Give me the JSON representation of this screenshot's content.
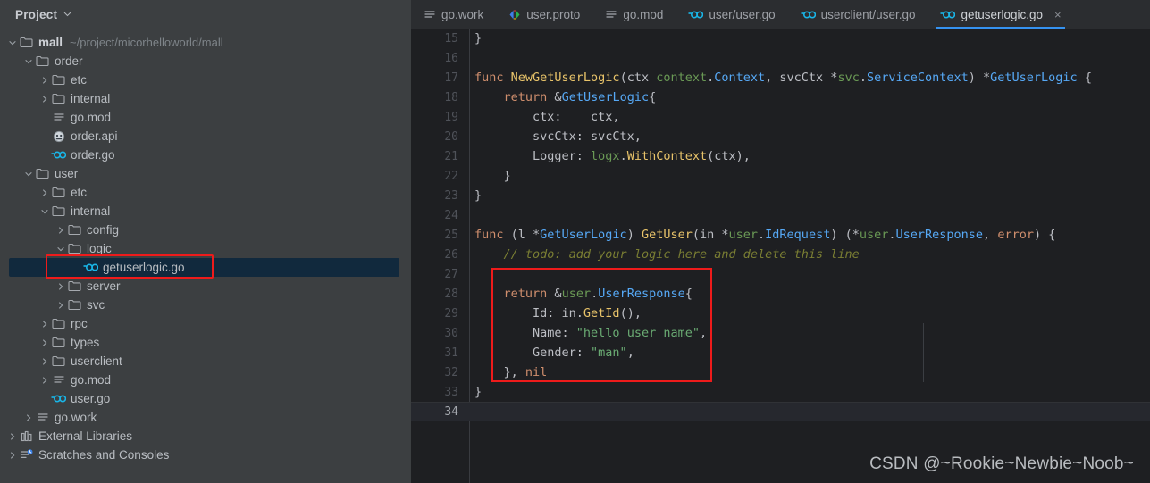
{
  "sidebar": {
    "header": {
      "title": "Project",
      "chevron_icon": "chevron-down-icon"
    },
    "tree": [
      {
        "indent": 0,
        "twisty": "down",
        "icon": "folder-icon",
        "label": "mall",
        "bold": true,
        "sub": "~/project/micorhelloworld/mall"
      },
      {
        "indent": 1,
        "twisty": "down",
        "icon": "folder-icon",
        "label": "order",
        "bold": false,
        "sub": ""
      },
      {
        "indent": 2,
        "twisty": "right",
        "icon": "folder-icon",
        "label": "etc",
        "bold": false,
        "sub": ""
      },
      {
        "indent": 2,
        "twisty": "right",
        "icon": "folder-icon",
        "label": "internal",
        "bold": false,
        "sub": ""
      },
      {
        "indent": 2,
        "twisty": "none",
        "icon": "text-file-icon",
        "label": "go.mod",
        "bold": false,
        "sub": ""
      },
      {
        "indent": 2,
        "twisty": "none",
        "icon": "api-file-icon",
        "label": "order.api",
        "bold": false,
        "sub": ""
      },
      {
        "indent": 2,
        "twisty": "none",
        "icon": "go-file-icon",
        "label": "order.go",
        "bold": false,
        "sub": ""
      },
      {
        "indent": 1,
        "twisty": "down",
        "icon": "folder-icon",
        "label": "user",
        "bold": false,
        "sub": ""
      },
      {
        "indent": 2,
        "twisty": "right",
        "icon": "folder-icon",
        "label": "etc",
        "bold": false,
        "sub": ""
      },
      {
        "indent": 2,
        "twisty": "down",
        "icon": "folder-icon",
        "label": "internal",
        "bold": false,
        "sub": ""
      },
      {
        "indent": 3,
        "twisty": "right",
        "icon": "folder-icon",
        "label": "config",
        "bold": false,
        "sub": ""
      },
      {
        "indent": 3,
        "twisty": "down",
        "icon": "folder-icon",
        "label": "logic",
        "bold": false,
        "sub": ""
      },
      {
        "indent": 4,
        "twisty": "none",
        "icon": "go-file-icon",
        "label": "getuserlogic.go",
        "bold": false,
        "sub": "",
        "selected": true
      },
      {
        "indent": 3,
        "twisty": "right",
        "icon": "folder-icon",
        "label": "server",
        "bold": false,
        "sub": ""
      },
      {
        "indent": 3,
        "twisty": "right",
        "icon": "folder-icon",
        "label": "svc",
        "bold": false,
        "sub": ""
      },
      {
        "indent": 2,
        "twisty": "right",
        "icon": "folder-icon",
        "label": "rpc",
        "bold": false,
        "sub": ""
      },
      {
        "indent": 2,
        "twisty": "right",
        "icon": "folder-icon",
        "label": "types",
        "bold": false,
        "sub": ""
      },
      {
        "indent": 2,
        "twisty": "right",
        "icon": "folder-icon",
        "label": "userclient",
        "bold": false,
        "sub": ""
      },
      {
        "indent": 2,
        "twisty": "right",
        "icon": "text-file-icon",
        "label": "go.mod",
        "bold": false,
        "sub": ""
      },
      {
        "indent": 2,
        "twisty": "none",
        "icon": "go-file-icon",
        "label": "user.go",
        "bold": false,
        "sub": ""
      },
      {
        "indent": 1,
        "twisty": "right",
        "icon": "text-file-icon",
        "label": "go.work",
        "bold": false,
        "sub": ""
      },
      {
        "indent": 0,
        "twisty": "right",
        "icon": "library-icon",
        "label": "External Libraries",
        "bold": false,
        "sub": ""
      },
      {
        "indent": 0,
        "twisty": "right",
        "icon": "scratches-icon",
        "label": "Scratches and Consoles",
        "bold": false,
        "sub": ""
      }
    ]
  },
  "tabs": [
    {
      "label": "go.work",
      "icon": "text-file-icon",
      "active": false,
      "closable": false
    },
    {
      "label": "user.proto",
      "icon": "proto-file-icon",
      "active": false,
      "closable": false
    },
    {
      "label": "go.mod",
      "icon": "text-file-icon",
      "active": false,
      "closable": false
    },
    {
      "label": "user/user.go",
      "icon": "go-file-icon",
      "active": false,
      "closable": false
    },
    {
      "label": "userclient/user.go",
      "icon": "go-file-icon",
      "active": false,
      "closable": false
    },
    {
      "label": "getuserlogic.go",
      "icon": "go-file-icon",
      "active": true,
      "closable": true,
      "close_label": "×"
    }
  ],
  "editor": {
    "lines": [
      {
        "num": "15",
        "tokens": [
          {
            "t": "}",
            "c": "plain"
          }
        ],
        "current": false
      },
      {
        "num": "16",
        "tokens": [],
        "current": false
      },
      {
        "num": "17",
        "tokens": [
          {
            "t": "func ",
            "c": "kw"
          },
          {
            "t": "NewGetUserLogic",
            "c": "fn"
          },
          {
            "t": "(ctx ",
            "c": "plain"
          },
          {
            "t": "context",
            "c": "pkg"
          },
          {
            "t": ".",
            "c": "plain"
          },
          {
            "t": "Context",
            "c": "typ"
          },
          {
            "t": ", svcCtx *",
            "c": "plain"
          },
          {
            "t": "svc",
            "c": "pkg"
          },
          {
            "t": ".",
            "c": "plain"
          },
          {
            "t": "ServiceContext",
            "c": "typ"
          },
          {
            "t": ") *",
            "c": "plain"
          },
          {
            "t": "GetUserLogic",
            "c": "typ"
          },
          {
            "t": " {",
            "c": "plain"
          }
        ],
        "current": false
      },
      {
        "num": "18",
        "tokens": [
          {
            "t": "    ",
            "c": "plain"
          },
          {
            "t": "return",
            "c": "kw"
          },
          {
            "t": " &",
            "c": "plain"
          },
          {
            "t": "GetUserLogic",
            "c": "typ"
          },
          {
            "t": "{",
            "c": "plain"
          }
        ],
        "current": false
      },
      {
        "num": "19",
        "tokens": [
          {
            "t": "        ctx:    ctx,",
            "c": "plain"
          }
        ],
        "current": false
      },
      {
        "num": "20",
        "tokens": [
          {
            "t": "        svcCtx: svcCtx,",
            "c": "plain"
          }
        ],
        "current": false
      },
      {
        "num": "21",
        "tokens": [
          {
            "t": "        Logger: ",
            "c": "plain"
          },
          {
            "t": "logx",
            "c": "pkg"
          },
          {
            "t": ".",
            "c": "plain"
          },
          {
            "t": "WithContext",
            "c": "fn"
          },
          {
            "t": "(ctx),",
            "c": "plain"
          }
        ],
        "current": false
      },
      {
        "num": "22",
        "tokens": [
          {
            "t": "    }",
            "c": "plain"
          }
        ],
        "current": false
      },
      {
        "num": "23",
        "tokens": [
          {
            "t": "}",
            "c": "plain"
          }
        ],
        "current": false
      },
      {
        "num": "24",
        "tokens": [],
        "current": false
      },
      {
        "num": "25",
        "tokens": [
          {
            "t": "func ",
            "c": "kw"
          },
          {
            "t": "(l *",
            "c": "plain"
          },
          {
            "t": "GetUserLogic",
            "c": "typ"
          },
          {
            "t": ") ",
            "c": "plain"
          },
          {
            "t": "GetUser",
            "c": "fn"
          },
          {
            "t": "(in *",
            "c": "plain"
          },
          {
            "t": "user",
            "c": "pkg"
          },
          {
            "t": ".",
            "c": "plain"
          },
          {
            "t": "IdRequest",
            "c": "typ"
          },
          {
            "t": ") (*",
            "c": "plain"
          },
          {
            "t": "user",
            "c": "pkg"
          },
          {
            "t": ".",
            "c": "plain"
          },
          {
            "t": "UserResponse",
            "c": "typ"
          },
          {
            "t": ", ",
            "c": "plain"
          },
          {
            "t": "error",
            "c": "kw"
          },
          {
            "t": ") {",
            "c": "plain"
          }
        ],
        "current": false
      },
      {
        "num": "26",
        "tokens": [
          {
            "t": "    ",
            "c": "plain"
          },
          {
            "t": "// todo: add your logic here and delete this line",
            "c": "cmt"
          }
        ],
        "current": false
      },
      {
        "num": "27",
        "tokens": [],
        "current": false
      },
      {
        "num": "28",
        "tokens": [
          {
            "t": "    ",
            "c": "plain"
          },
          {
            "t": "return",
            "c": "kw"
          },
          {
            "t": " &",
            "c": "plain"
          },
          {
            "t": "user",
            "c": "pkg"
          },
          {
            "t": ".",
            "c": "plain"
          },
          {
            "t": "UserResponse",
            "c": "typ"
          },
          {
            "t": "{",
            "c": "plain"
          }
        ],
        "current": false
      },
      {
        "num": "29",
        "tokens": [
          {
            "t": "        Id: in.",
            "c": "plain"
          },
          {
            "t": "GetId",
            "c": "fn"
          },
          {
            "t": "(),",
            "c": "plain"
          }
        ],
        "current": false
      },
      {
        "num": "30",
        "tokens": [
          {
            "t": "        Name: ",
            "c": "plain"
          },
          {
            "t": "\"hello user name\"",
            "c": "str"
          },
          {
            "t": ",",
            "c": "plain"
          }
        ],
        "current": false
      },
      {
        "num": "31",
        "tokens": [
          {
            "t": "        Gender: ",
            "c": "plain"
          },
          {
            "t": "\"man\"",
            "c": "str"
          },
          {
            "t": ",",
            "c": "plain"
          }
        ],
        "current": false
      },
      {
        "num": "32",
        "tokens": [
          {
            "t": "    }, ",
            "c": "plain"
          },
          {
            "t": "nil",
            "c": "kw"
          }
        ],
        "current": false
      },
      {
        "num": "33",
        "tokens": [
          {
            "t": "}",
            "c": "plain"
          }
        ],
        "current": false
      },
      {
        "num": "34",
        "tokens": [],
        "current": true
      }
    ]
  },
  "annotations": {
    "sidebar_highlight": {
      "color": "#ee1b1b"
    },
    "code_highlight": {
      "color": "#ee1b1b"
    }
  },
  "watermark": {
    "text": "CSDN @~Rookie~Newbie~Noob~"
  },
  "colors": {
    "sidebar_bg": "#3c3f41",
    "editor_bg": "#1e1f22",
    "tabbar_bg": "#2b2d30",
    "selection_bg": "#11293d",
    "active_tab_underline": "#3592f0",
    "annotation_red": "#ee1b1b"
  }
}
